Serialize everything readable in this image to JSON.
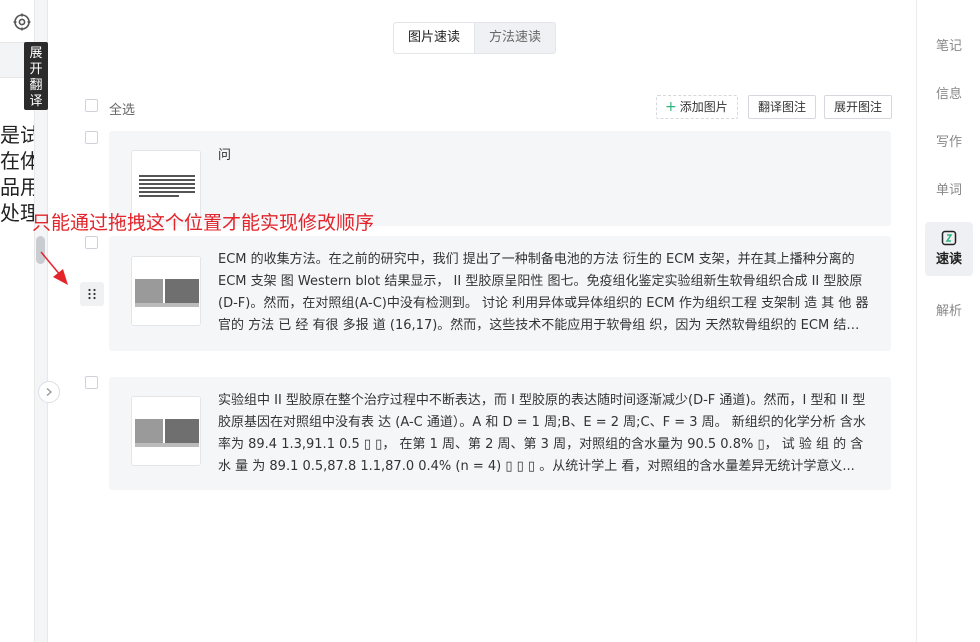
{
  "left": {
    "translate_tab": [
      "展",
      "开",
      "翻",
      "译"
    ],
    "peek_lines": [
      "是试验",
      "在体内",
      "品用",
      "处理"
    ]
  },
  "tabs": [
    {
      "label": "图片速读",
      "active": true
    },
    {
      "label": "方法速读",
      "active": false
    }
  ],
  "toolbar": {
    "select_all": "全选",
    "add_image": "添加图片",
    "translate_caption": "翻译图注",
    "expand_caption": "展开图注"
  },
  "cards": [
    {
      "text": "问"
    },
    {
      "text": "ECM 的收集方法。在之前的研究中，我们 提出了一种制备电池的方法 衍生的 ECM 支架，并在其上播种分离的 ECM 支架 图 Western blot 结果显示， II 型胶原呈阳性 图七。免疫组化鉴定实验组新生软骨组织合成 II 型胶原(D-F)。然而，在对照组(A-C)中没有检测到。 讨论 利用异体或异体组织的 ECM 作为组织工程 支架制 造 其 他 器 官的 方法 已 经 有很 多报 道 (16,17)。然而，这些技术不能应用于软骨组 织，因为 天然软骨组织的 ECM 结构致密..."
    },
    {
      "text": "实验组中 II 型胶原在整个治疗过程中不断表达，而 I 型胶原的表达随时间逐渐减少(D-F 通道)。然而，I 型和 II 型胶原基因在对照组中没有表 达 (A-C 通道）。A 和 D = 1 周;B、E = 2 周;C、F = 3 周。 新组织的化学分析 含水率为 89.4 1.3,91.1 0.5 ▯ ▯， 在第 1 周、第 2 周、第 3 周，对照组的含水量为 90.5 0.8% ▯， 试 验 组 的 含 水 量 为 89.1 0.5,87.8 1.1,87.0 0.4% (n = 4) ▯ ▯ ▯ 。从统计学上 看，对照组的含水量差异无统计学意义..."
    }
  ],
  "annotation": "只能通过拖拽这个位置才能实现修改顺序",
  "right_nav": [
    {
      "label": "笔记"
    },
    {
      "label": "信息"
    },
    {
      "label": "写作"
    },
    {
      "label": "单词"
    },
    {
      "label": "速读",
      "active": true
    },
    {
      "label": "解析"
    }
  ],
  "colors": {
    "accent_green": "#2fb47c",
    "annotation_red": "#e3242b"
  }
}
